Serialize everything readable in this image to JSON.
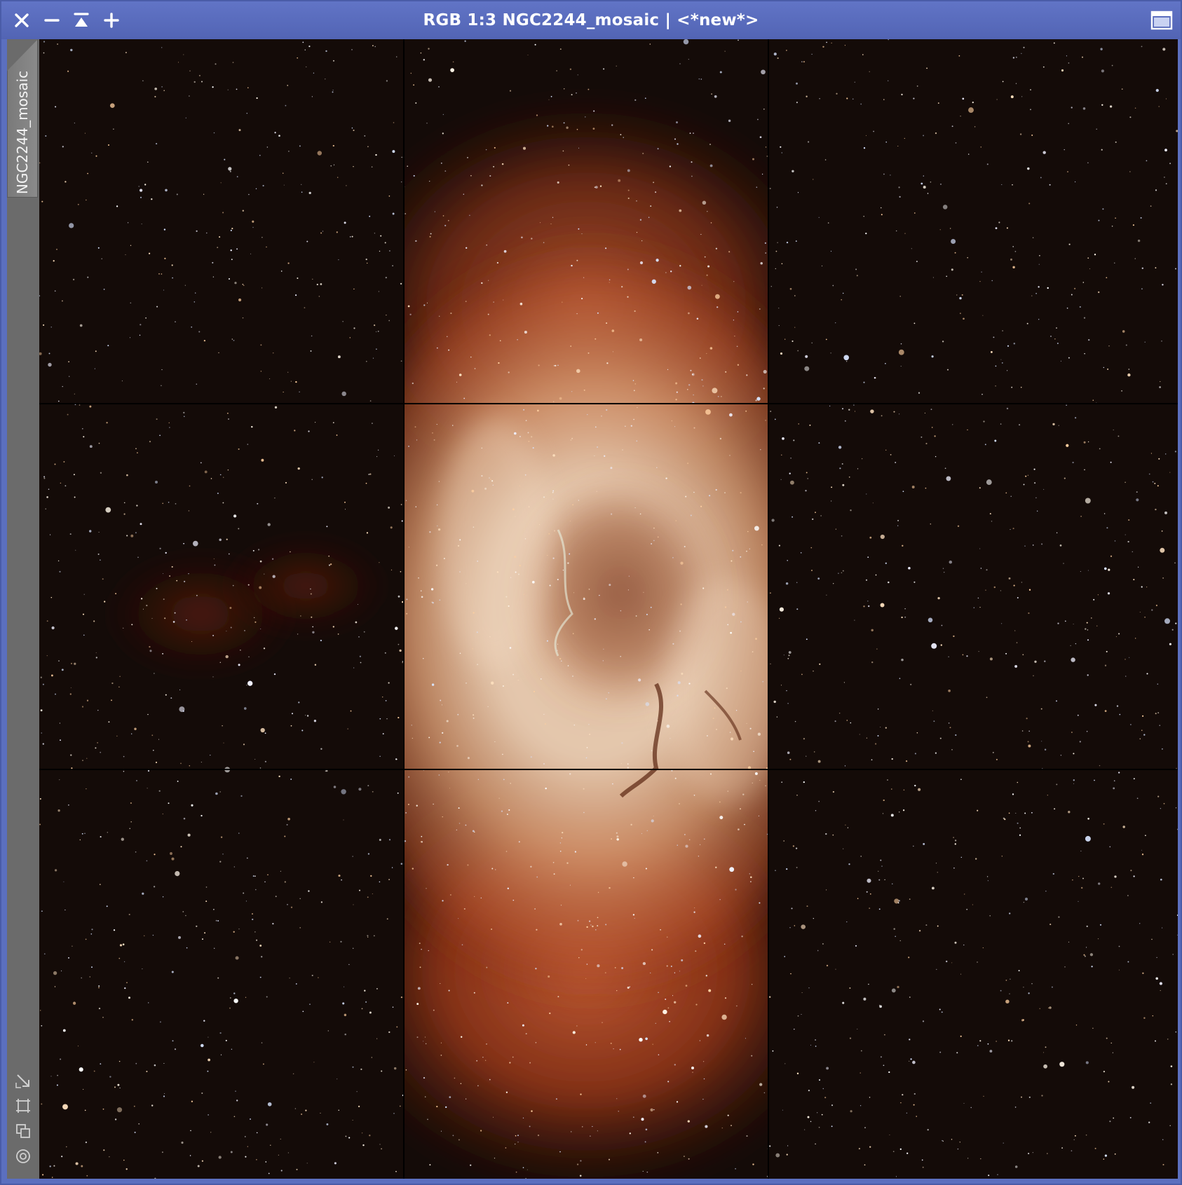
{
  "window": {
    "title": "RGB 1:3 NGC2244_mosaic | <*new*>",
    "view_id": "NGC2244_mosaic",
    "accent_color": "#5b6fbf"
  },
  "titlebar_controls": [
    {
      "name": "close-button",
      "icon": "close-icon"
    },
    {
      "name": "minimize-button",
      "icon": "minus-icon"
    },
    {
      "name": "shade-button",
      "icon": "collapse-to-top-icon"
    },
    {
      "name": "zoom-in-button",
      "icon": "plus-icon"
    },
    {
      "name": "maximize-button",
      "icon": "maximize-window-icon"
    }
  ],
  "sidebar_tools": [
    {
      "name": "fit-view-tool",
      "icon": "shrink-arrow-icon"
    },
    {
      "name": "preview-mode-tool",
      "icon": "frame-corners-icon"
    },
    {
      "name": "clone-view-tool",
      "icon": "overlapping-squares-icon"
    },
    {
      "name": "center-view-tool",
      "icon": "target-circle-icon"
    }
  ],
  "image": {
    "subject": "NGC 2244 Rosette Nebula mosaic",
    "mosaic_grid": {
      "rows": 3,
      "columns": 3
    },
    "zoom": "1:3",
    "colors": {
      "sky": "#120a07",
      "nebula_core": "#f3d9bf",
      "nebula_mid": "#d98a5c",
      "nebula_edge": "#a83a1c",
      "seam": "#000000"
    }
  }
}
